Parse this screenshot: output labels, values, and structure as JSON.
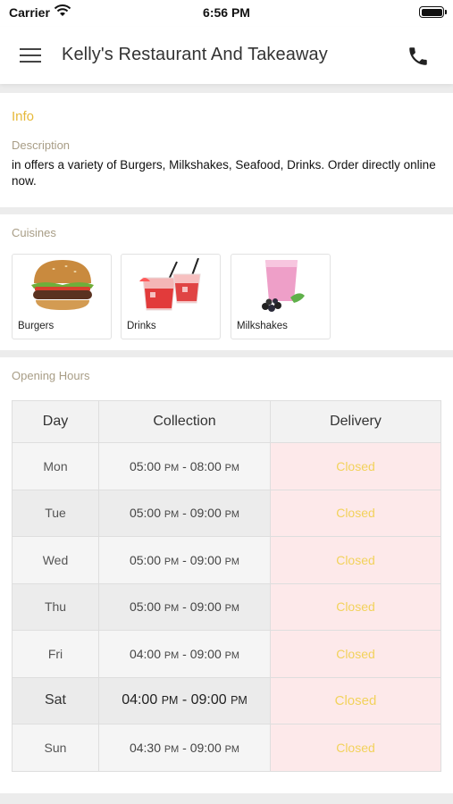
{
  "status_bar": {
    "carrier": "Carrier",
    "time": "6:56 PM"
  },
  "header": {
    "title": "Kelly's Restaurant And Takeaway"
  },
  "info": {
    "heading": "Info",
    "description_label": "Description",
    "description": "in  offers a variety of Burgers, Milkshakes, Seafood, Drinks. Order directly online now."
  },
  "cuisines": {
    "heading": "Cuisines",
    "items": [
      {
        "label": "Burgers",
        "icon": "burger-icon"
      },
      {
        "label": "Drinks",
        "icon": "drinks-icon"
      },
      {
        "label": "Milkshakes",
        "icon": "milkshake-icon"
      }
    ]
  },
  "opening_hours": {
    "heading": "Opening Hours",
    "columns": [
      "Day",
      "Collection",
      "Delivery"
    ],
    "rows": [
      {
        "day": "Mon",
        "collection_from": "05:00",
        "collection_to": "08:00",
        "delivery": "Closed"
      },
      {
        "day": "Tue",
        "collection_from": "05:00",
        "collection_to": "09:00",
        "delivery": "Closed"
      },
      {
        "day": "Wed",
        "collection_from": "05:00",
        "collection_to": "09:00",
        "delivery": "Closed"
      },
      {
        "day": "Thu",
        "collection_from": "05:00",
        "collection_to": "09:00",
        "delivery": "Closed"
      },
      {
        "day": "Fri",
        "collection_from": "04:00",
        "collection_to": "09:00",
        "delivery": "Closed"
      },
      {
        "day": "Sat",
        "collection_from": "04:00",
        "collection_to": "09:00",
        "delivery": "Closed"
      },
      {
        "day": "Sun",
        "collection_from": "04:30",
        "collection_to": "09:00",
        "delivery": "Closed"
      }
    ],
    "ampm": "PM",
    "highlighted_day": "Sat"
  },
  "colors": {
    "accent": "#e6b93a",
    "closed_text": "#f2d25c",
    "closed_bg": "#fde9ea"
  }
}
